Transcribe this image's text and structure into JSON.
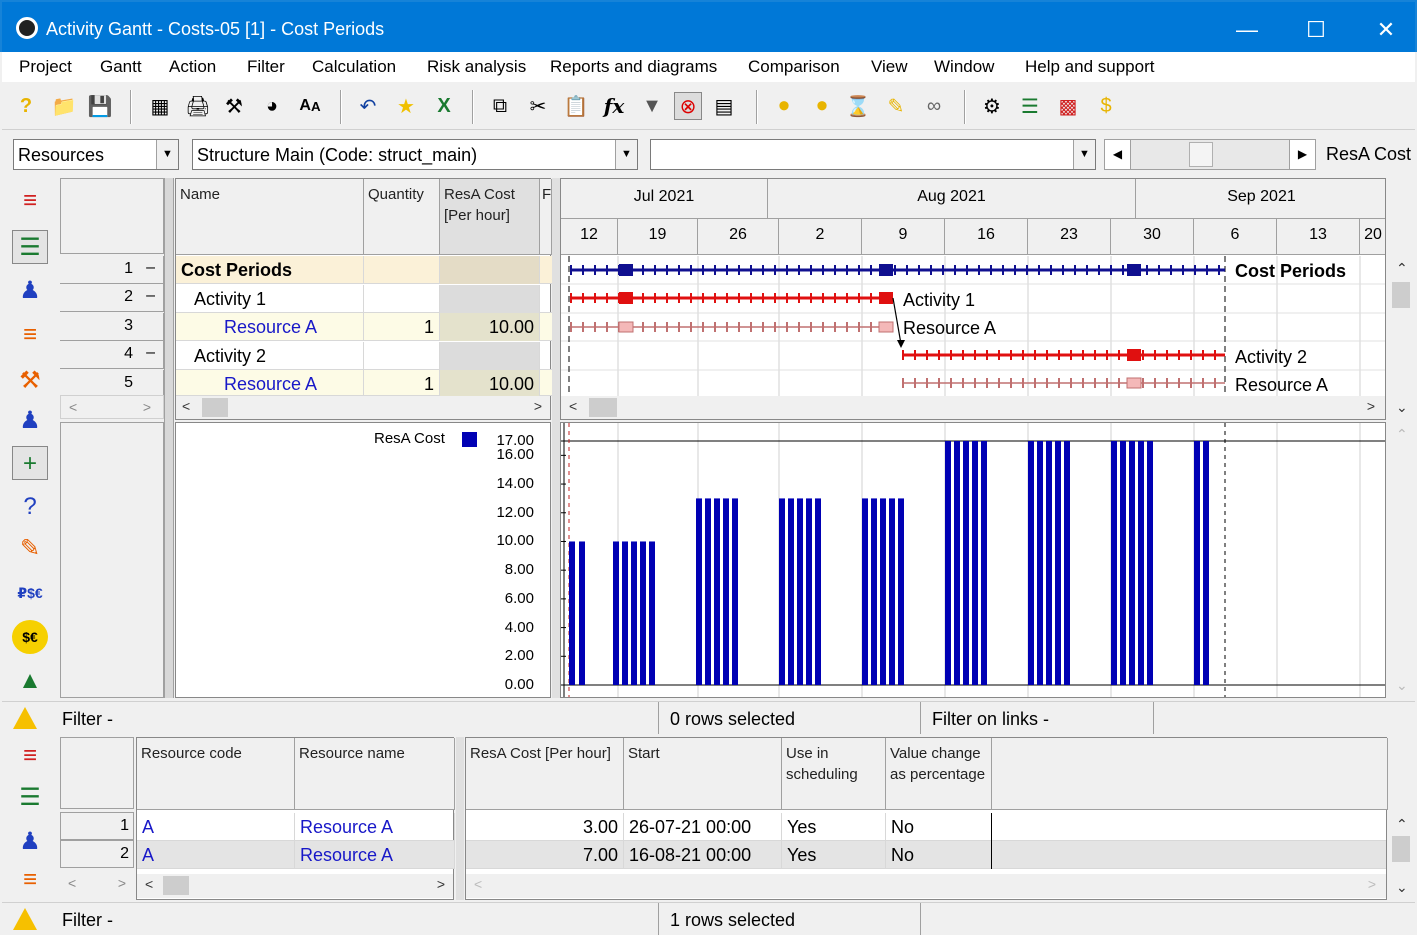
{
  "window": {
    "title": "Activity Gantt - Costs-05 [1] - Cost Periods"
  },
  "menu": [
    "Project",
    "Gantt",
    "Action",
    "Filter",
    "Calculation",
    "Risk analysis",
    "Reports and diagrams",
    "Comparison",
    "View",
    "Window",
    "Help and support"
  ],
  "combos": {
    "view": "Resources",
    "structure": "Structure Main (Code: struct_main)",
    "extra": "",
    "right_label": "ResA Cost"
  },
  "grid": {
    "headers": {
      "name": "Name",
      "quantity": "Quantity",
      "cost": "ResA Cost [Per hour]",
      "extra": "F"
    },
    "rows": [
      {
        "num": "1",
        "mark": "–",
        "name": "Cost Periods",
        "qty": "",
        "cost": ""
      },
      {
        "num": "2",
        "mark": "–",
        "name": "Activity 1",
        "qty": "",
        "cost": ""
      },
      {
        "num": "3",
        "mark": "",
        "name": "Resource A",
        "qty": "1",
        "cost": "10.00"
      },
      {
        "num": "4",
        "mark": "–",
        "name": "Activity 2",
        "qty": "",
        "cost": ""
      },
      {
        "num": "5",
        "mark": "",
        "name": "Resource A",
        "qty": "1",
        "cost": "10.00"
      }
    ]
  },
  "timeline": {
    "months": [
      "Jul 2021",
      "Aug 2021",
      "Sep 2021"
    ],
    "weeks": [
      "12",
      "19",
      "26",
      "2",
      "9",
      "16",
      "23",
      "30",
      "6",
      "13",
      "20"
    ]
  },
  "gantt_labels": [
    "Cost Periods",
    "Activity 1",
    "Resource A",
    "Activity 2",
    "Resource A"
  ],
  "histogram": {
    "legend": "ResA Cost",
    "legend_color": "#0000b4"
  },
  "chart_data": {
    "type": "bar",
    "ylim": [
      0,
      17
    ],
    "yticks": [
      "17.00",
      "16.00",
      "14.00",
      "12.00",
      "10.00",
      "8.00",
      "6.00",
      "4.00",
      "2.00",
      "0.00"
    ],
    "series": [
      {
        "name": "ResA Cost",
        "values": [
          10,
          10,
          10,
          10,
          10,
          10,
          10,
          13,
          13,
          13,
          13,
          13,
          13,
          13,
          13,
          13,
          13,
          13,
          13,
          13,
          13,
          13,
          17,
          17,
          17,
          17,
          17,
          17,
          17,
          17,
          17,
          17,
          17,
          17,
          17,
          17,
          17,
          17,
          17
        ]
      }
    ]
  },
  "status1": {
    "filter": "Filter -",
    "selected": "0 rows selected",
    "links": "Filter on links -"
  },
  "bottom_grid": {
    "headers": {
      "code": "Resource code",
      "name": "Resource name",
      "cost": "ResA Cost [Per hour]",
      "start": "Start",
      "use": "Use in scheduling",
      "value": "Value change as percentage"
    },
    "rows": [
      {
        "num": "1",
        "code": "A",
        "name": "Resource A",
        "cost": "3.00",
        "start": "26-07-21  00:00",
        "use": "Yes",
        "value": "No"
      },
      {
        "num": "2",
        "code": "A",
        "name": "Resource A",
        "cost": "7.00",
        "start": "16-08-21  00:00",
        "use": "Yes",
        "value": "No"
      }
    ]
  },
  "status2": {
    "filter": "Filter -",
    "selected": "1 rows selected"
  }
}
